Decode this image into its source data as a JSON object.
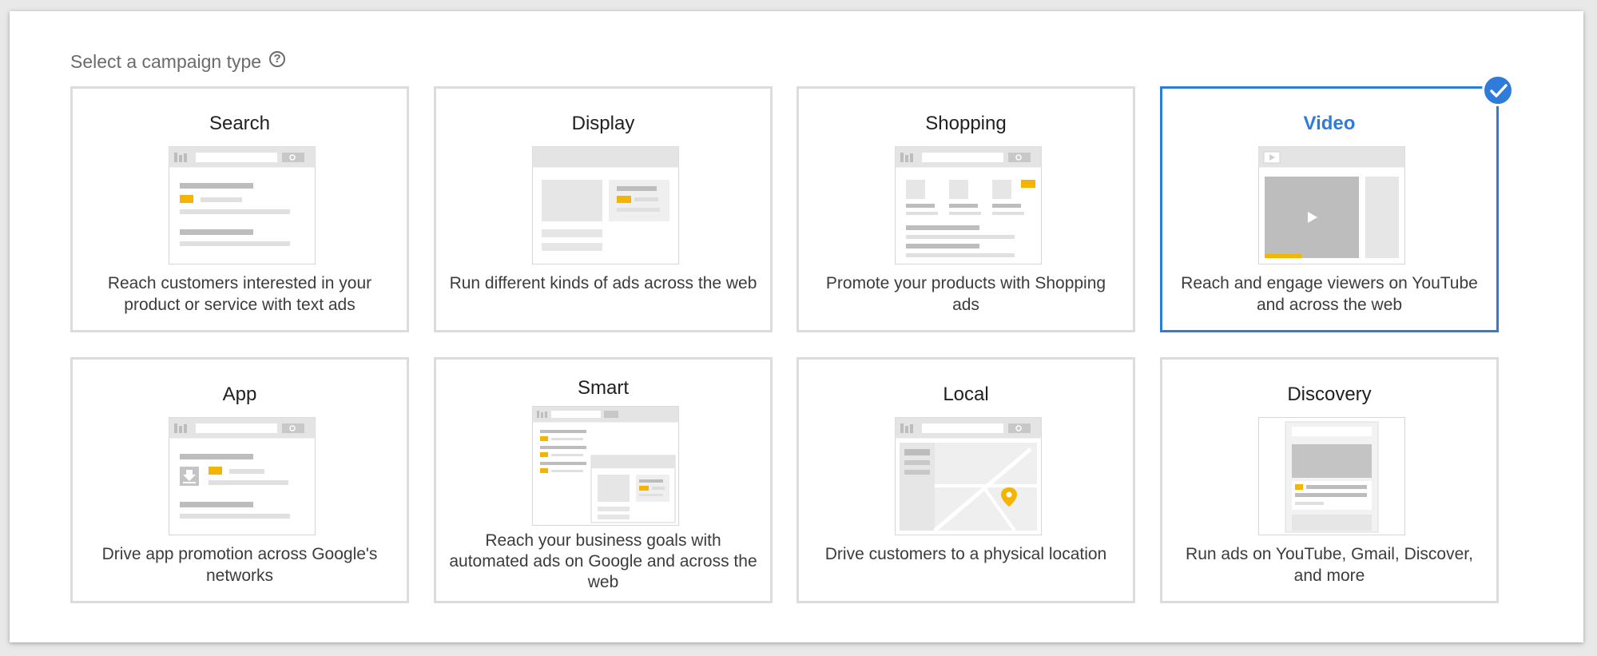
{
  "heading": {
    "label": "Select a campaign type",
    "help_icon": "help-circle-icon"
  },
  "cards": [
    {
      "title": "Search",
      "description": "Reach customers interested in your product or service with text ads",
      "selected": false
    },
    {
      "title": "Display",
      "description": "Run different kinds of ads across the web",
      "selected": false
    },
    {
      "title": "Shopping",
      "description": "Promote your products with Shopping ads",
      "selected": false
    },
    {
      "title": "Video",
      "description": "Reach and engage viewers on YouTube and across the web",
      "selected": true
    },
    {
      "title": "App",
      "description": "Drive app promotion across Google's networks",
      "selected": false
    },
    {
      "title": "Smart",
      "description": "Reach your business goals with automated ads on Google and across the web",
      "selected": false
    },
    {
      "title": "Local",
      "description": "Drive customers to a physical location",
      "selected": false
    },
    {
      "title": "Discovery",
      "description": "Run ads on YouTube, Gmail, Discover, and more",
      "selected": false
    }
  ],
  "colors": {
    "selected": "#2f7bd9",
    "accent": "#f4b400",
    "border": "#dcdcdc"
  }
}
